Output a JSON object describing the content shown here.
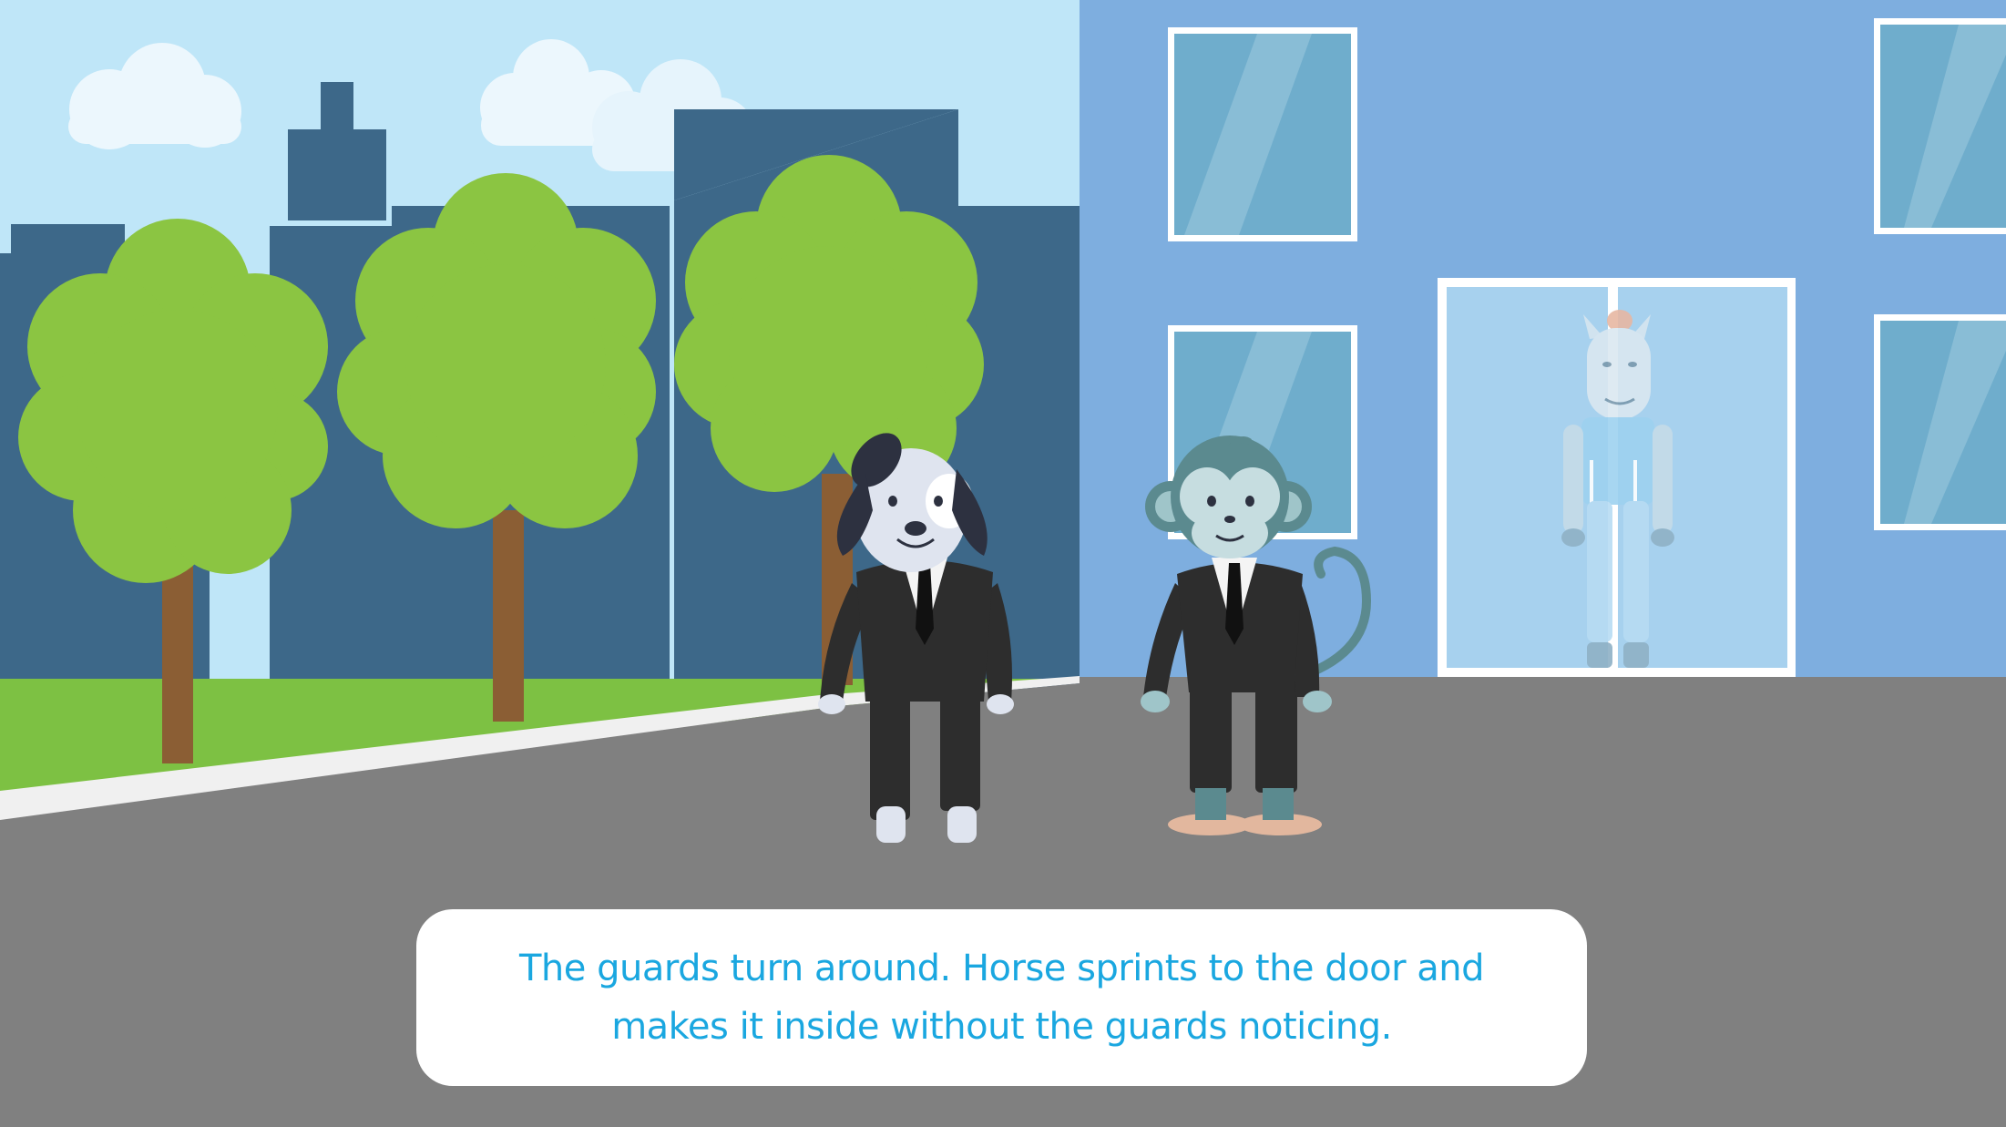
{
  "dialog": {
    "text": "The guards turn around. Horse sprints to the door and makes it inside without the guards noticing."
  },
  "characters": {
    "dog": {
      "role": "guard",
      "outfit": "black suit"
    },
    "monkey": {
      "role": "guard",
      "outfit": "black suit"
    },
    "horse": {
      "role": "player",
      "location": "inside glass door"
    }
  },
  "colors": {
    "sky": "#bfe6f8",
    "city_buildings": "#3d6889",
    "building_wall": "#7eaedf",
    "window_glass": "#6fadcc",
    "tree_foliage": "#8bc542",
    "tree_trunk": "#8b5e34",
    "grass": "#7dc143",
    "road": "#808080",
    "suit": "#2d2d2d",
    "dialog_text": "#1aa7e0"
  }
}
